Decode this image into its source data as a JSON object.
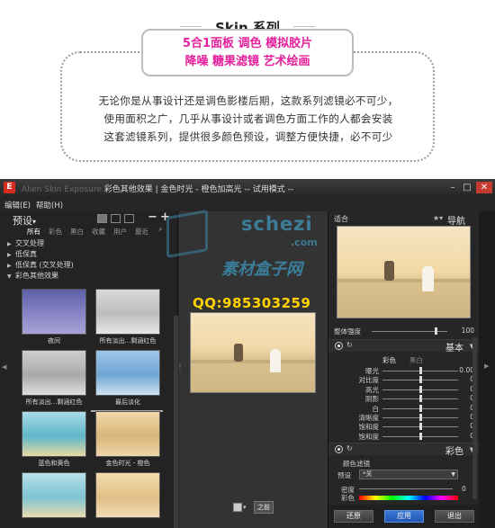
{
  "promo": {
    "title": "Skin 系列",
    "pink_line1": "5合1面板 调色 模拟胶片",
    "pink_line2": "降噪 糖果滤镜 艺术绘画",
    "desc_line1": "无论你是从事设计还是调色影楼后期，这款系列滤镜必不可少，",
    "desc_line2": "使用面积之广，几乎从事设计或者调色方面工作的人都会安装",
    "desc_line3": "这套滤镜系列，提供很多颜色预设，调整方便快捷，必不可少",
    "pink_color": "#e4209c"
  },
  "window": {
    "app_icon_letter": "E",
    "title": "彩色其他效果 | 金色时光 - 橙色加高光 -- 试用模式 --",
    "title_faint": "Alien Skin Exposure",
    "controls": {
      "minimize": "–",
      "maximize": "□",
      "close": "✕"
    },
    "menu": [
      "编辑(E)",
      "帮助(H)"
    ]
  },
  "left": {
    "panel_title": "预设",
    "panel_title_arrow": "▾",
    "filter_tabs": [
      "所有",
      "彩色",
      "黑白",
      "收藏",
      "用户",
      "最近"
    ],
    "active_tab": "所有",
    "tree": [
      {
        "label": "交叉处理",
        "arrow": "▶"
      },
      {
        "label": "低保真",
        "arrow": "▶"
      },
      {
        "label": "低保真 (交叉处理)",
        "arrow": "▶"
      },
      {
        "label": "彩色其他效果",
        "arrow": "▼"
      }
    ],
    "thumbnails": [
      {
        "caption": "夜间",
        "tone": "purple"
      },
      {
        "caption": "所有淡出...剩涵红色",
        "tone": "gray"
      },
      {
        "caption": "所有淡出...剩涵红色",
        "tone": "gray"
      },
      {
        "caption": "最后淡化",
        "tone": "blue"
      },
      {
        "caption": "蓝色和黄色",
        "tone": "teal"
      },
      {
        "caption": "金色时光 - 橙色",
        "tone": "warm"
      },
      {
        "caption": "",
        "tone": "teal"
      },
      {
        "caption": "",
        "tone": "warm"
      }
    ]
  },
  "center": {
    "before_label": "之前",
    "square_dropdown": "▾"
  },
  "right": {
    "fit_label": "适合",
    "nav_label": "导航",
    "overall_label": "整体强度",
    "overall_value": "100",
    "basic_section": "基本",
    "color_tab": "彩色",
    "bw_tab": "黑白",
    "sliders": [
      {
        "label": "曝光",
        "value": "0.00",
        "pos": 0.5
      },
      {
        "label": "对比度",
        "value": "0",
        "pos": 0.5
      },
      {
        "label": "高光",
        "value": "0",
        "pos": 0.5
      },
      {
        "label": "阴影",
        "value": "0",
        "pos": 0.5
      },
      {
        "label": "白",
        "value": "0",
        "pos": 0.5
      },
      {
        "label": "清晰度",
        "value": "0",
        "pos": 0.5
      },
      {
        "label": "饱和度",
        "value": "0",
        "pos": 0.5
      },
      {
        "label": "饱和度",
        "value": "0",
        "pos": 0.5
      }
    ],
    "color_section": "彩色",
    "color_filter_label": "颜色滤镜",
    "preset_label": "预设",
    "preset_value": "*关",
    "density_label": "密度",
    "density_value": "0",
    "hue_label": "彩色",
    "buttons": {
      "reset": "还原",
      "apply": "应用",
      "exit": "退出"
    }
  },
  "watermark": {
    "site": "schezi",
    "com": ".com",
    "cn": "素材盒子网",
    "qq": "QQ:985303259"
  }
}
